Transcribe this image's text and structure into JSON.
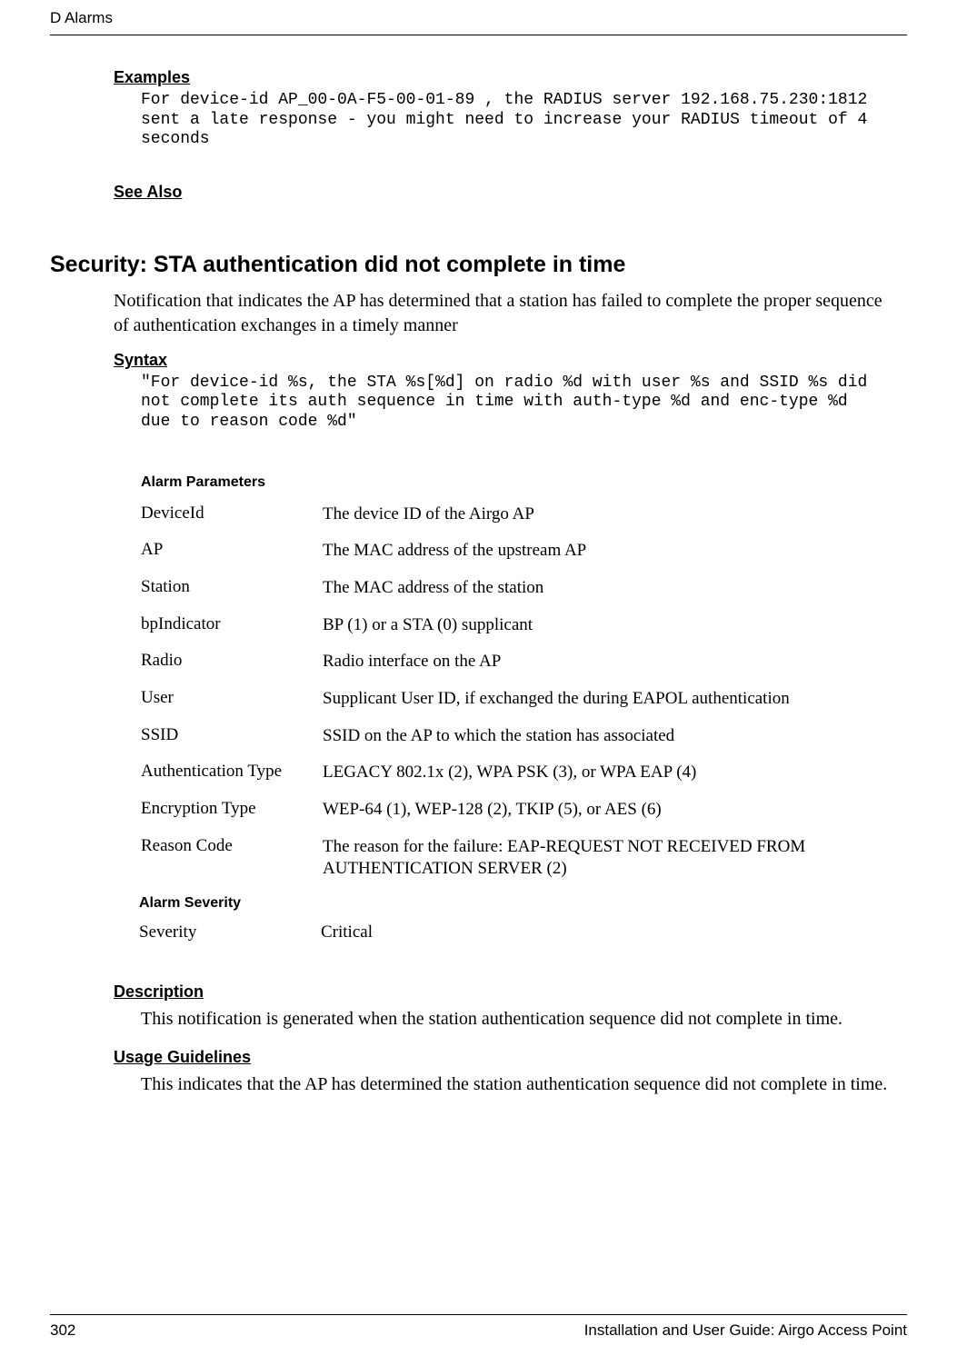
{
  "header": {
    "left": "D Alarms",
    "right": ""
  },
  "sec_examples": "Examples",
  "examples_code": "For device-id AP_00-0A-F5-00-01-89 , the RADIUS server 192.168.75.230:1812 sent a late response - you might need to increase your RADIUS timeout of 4 seconds",
  "sec_seealso": "See Also",
  "main_title": "Security: STA authentication did not complete in time",
  "intro_para": "Notification that indicates the AP has determined that a station has failed to complete the proper sequence of authentication exchanges in a timely manner",
  "sec_syntax": "Syntax",
  "syntax_code": "\"For device-id %s, the STA %s[%d] on radio %d with user %s and SSID %s did not complete its auth sequence in time with auth-type %d and enc-type %d due to reason code %d\"",
  "alarm_params_title": "Alarm Parameters",
  "params": [
    {
      "key": "DeviceId",
      "val": "The device ID of the Airgo AP"
    },
    {
      "key": "AP",
      "val": "The MAC address of the upstream AP"
    },
    {
      "key": "Station",
      "val": "The MAC address of the station"
    },
    {
      "key": "bpIndicator",
      "val": "BP (1) or a STA (0) supplicant"
    },
    {
      "key": "Radio",
      "val": "Radio interface on the AP"
    },
    {
      "key": "User",
      "val": "Supplicant User ID, if exchanged the during EAPOL authentication"
    },
    {
      "key": "SSID",
      "val": "SSID on the AP to which the station has associated"
    },
    {
      "key": "Authentication Type",
      "val": "LEGACY 802.1x (2), WPA PSK (3), or WPA EAP (4)"
    },
    {
      "key": "Encryption Type",
      "val": "WEP-64 (1), WEP-128 (2), TKIP (5), or AES (6)"
    },
    {
      "key": "Reason Code",
      "val": "The reason for the failure: EAP-REQUEST NOT RECEIVED FROM  AUTHENTICATION SERVER (2)"
    }
  ],
  "alarm_severity_title": "Alarm Severity",
  "severity_key": "Severity",
  "severity_val": "Critical",
  "sec_description": "Description",
  "description_para": "This notification is generated when the station authentication sequence did not complete in time.",
  "sec_usage": "Usage Guidelines",
  "usage_para": "This indicates that the AP has determined the station authentication sequence did not complete in time.",
  "footer": {
    "page": "302",
    "doc": "Installation and User Guide: Airgo Access Point"
  }
}
